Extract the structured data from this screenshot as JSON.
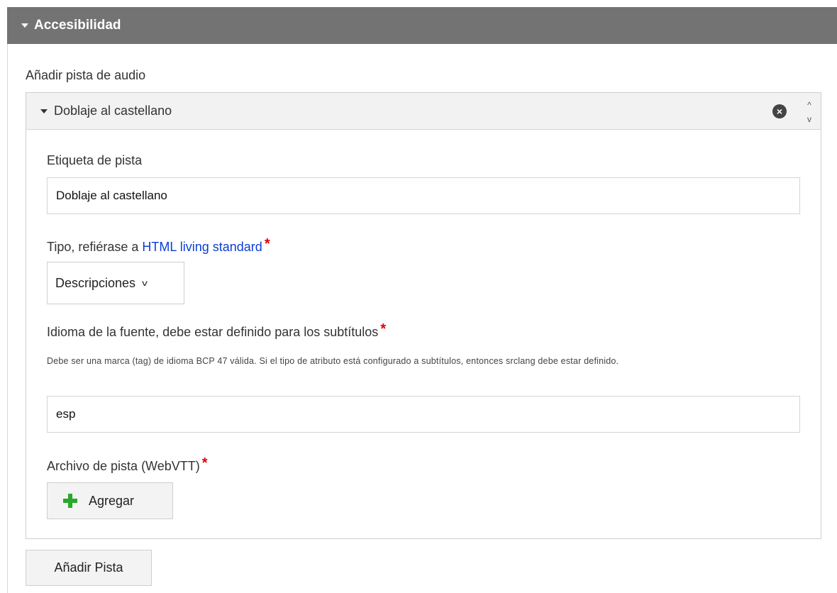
{
  "section": {
    "title": "Accesibilidad"
  },
  "audio": {
    "label": "Añadir pista de audio"
  },
  "track": {
    "header_title": "Doblaje al castellano",
    "label_field": {
      "label": "Etiqueta de pista",
      "value": "Doblaje al castellano"
    },
    "type_field": {
      "label_prefix": "Tipo, refiérase a ",
      "label_link": "HTML living standard",
      "required_mark": "*",
      "selected": "Descripciones"
    },
    "language_field": {
      "label": "Idioma de la fuente, debe estar definido para los subtítulos",
      "required_mark": "*",
      "help": "Debe ser una marca (tag) de idioma BCP 47 válida. Si el tipo de atributo está configurado a subtítulos, entonces srclang debe estar definido.",
      "value": "esp"
    },
    "file_field": {
      "label": "Archivo de pista (WebVTT)",
      "required_mark": "*",
      "add_button": "Agregar"
    },
    "icons": {
      "remove": "×",
      "move_up": "^",
      "move_down": "v",
      "select_chevron": "v"
    }
  },
  "add_track_button": "Añadir Pista",
  "colors": {
    "header_bg": "#737373",
    "link": "#0b3fd6",
    "required": "#e00000",
    "plus_icon": "#2aa82a"
  }
}
